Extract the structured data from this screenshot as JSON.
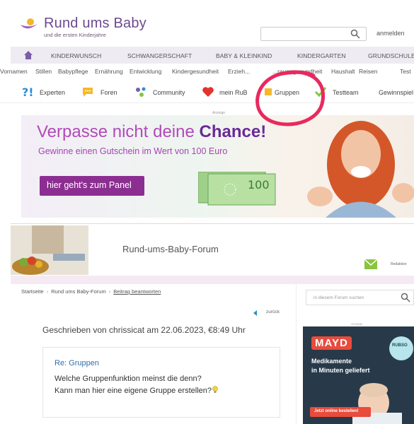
{
  "header": {
    "logo_title": "Rund ums Baby",
    "logo_sub": "und die ersten Kinderjahre",
    "login": "anmelden"
  },
  "main_nav": [
    "KINDERWUNSCH",
    "SCHWANGERSCHAFT",
    "BABY & KLEINKIND",
    "KINDERGARTEN",
    "GRUNDSCHULE"
  ],
  "sub_nav": [
    "Vornamen",
    "Stillen",
    "Babypflege",
    "Ernährung",
    "Entwicklung",
    "Kindergesundheit",
    "Erzieh...",
    "...rauengesundheit",
    "Haushalt",
    "Reisen",
    "Test"
  ],
  "sec_nav": [
    "Experten",
    "Foren",
    "Community",
    "mein RuB",
    "Gruppen",
    "Testteam",
    "Gewinnspiel"
  ],
  "banner": {
    "ad_label": "Anzeige",
    "title_pre": "Verpasse nicht deine ",
    "title_bold": "Chance!",
    "subtitle": "Gewinne einen Gutschein im Wert von 100 Euro",
    "button": "hier geht's zum Panel",
    "note_value": "100"
  },
  "forum": {
    "title": "Rund-ums-Baby-Forum",
    "redaktion": "Redaktion"
  },
  "breadcrumb": [
    "Startseite",
    "Rund ums Baby-Forum",
    "Beitrag beantworten"
  ],
  "back_link": "zurück",
  "post": {
    "written": "Geschrieben von  chrissicat  am 22.06.2023, €8:49 Uhr",
    "subject": "Re: Gruppen",
    "line1": "Welche Gruppenfunktion meinst die denn?",
    "line2": "Kann man hier eine eigene Gruppe erstellen?"
  },
  "sidebar": {
    "search_placeholder": "in diesem Forum suchen",
    "ad_label": "Anzeige",
    "ad_logo": "MAYD",
    "ad_text1": "Medikamente",
    "ad_text2": "in Minuten geliefert",
    "ad_button": "Jetzt online bestellen!",
    "ad_badge": "RUBSO"
  },
  "colors": {
    "brand_purple": "#6b4a8f",
    "banner_button": "#8c2e91",
    "annotation_circle": "#e8295f",
    "mayd_red": "#e94b3c"
  }
}
